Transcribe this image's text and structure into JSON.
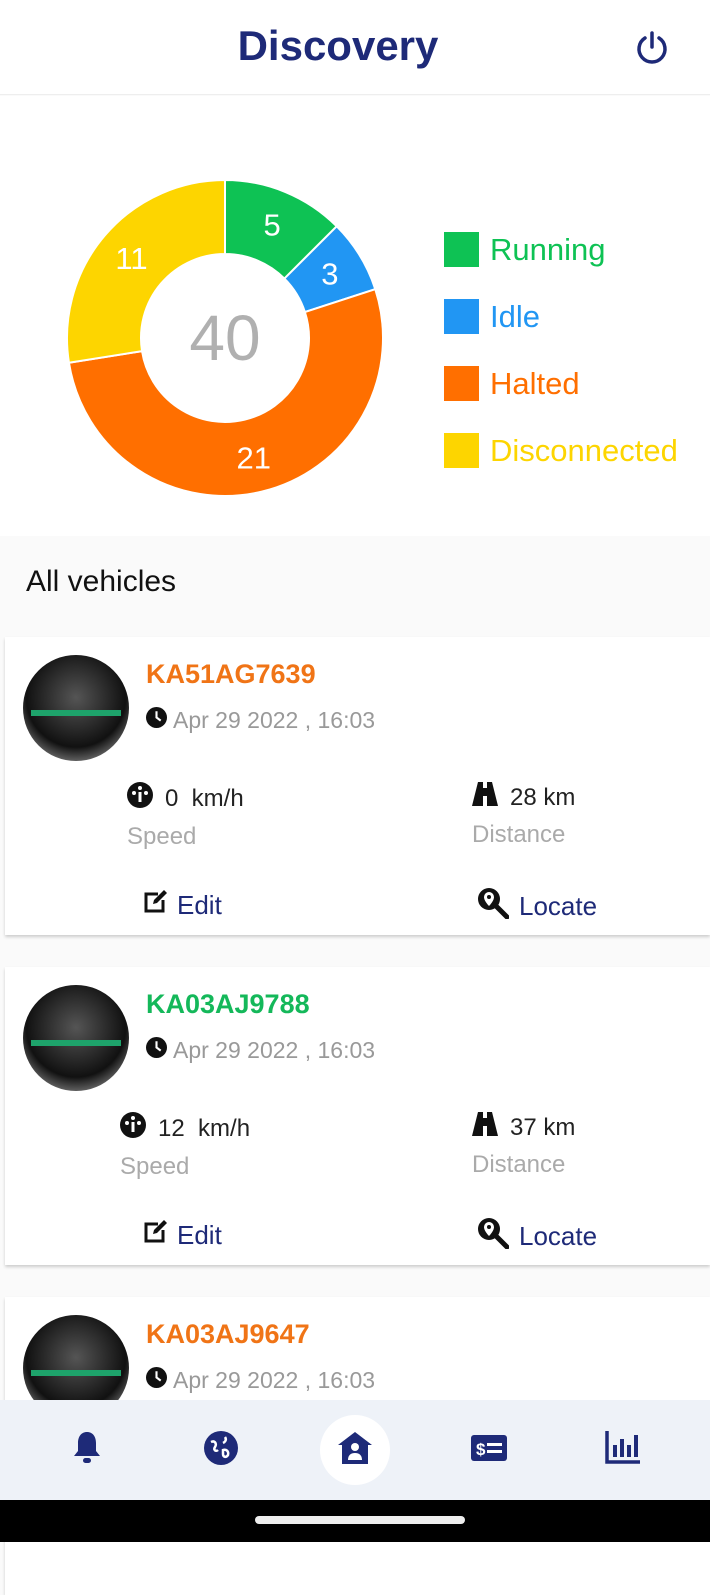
{
  "header": {
    "title": "Discovery",
    "power_icon": "power-icon"
  },
  "chart_data": {
    "type": "pie",
    "variant": "donut",
    "total": "40",
    "series": [
      {
        "name": "Running",
        "value": 5,
        "color": "#0ec254"
      },
      {
        "name": "Idle",
        "value": 3,
        "color": "#2196f3"
      },
      {
        "name": "Halted",
        "value": 21,
        "color": "#ff6f00"
      },
      {
        "name": "Disconnected",
        "value": 11,
        "color": "#fdd500"
      }
    ],
    "legend_placement": "right"
  },
  "section_title": "All vehicles",
  "vehicles": [
    {
      "plate": "KA51AG7639",
      "plate_color": "#f07416",
      "time": "Apr 29 2022 , 16:03",
      "speed": "0  km/h",
      "speed_label": "Speed",
      "distance": "28 km",
      "distance_label": "Distance",
      "edit": "Edit",
      "locate": "Locate"
    },
    {
      "plate": "KA03AJ9788",
      "plate_color": "#14b85a",
      "time": "Apr 29 2022 , 16:03",
      "speed": "12  km/h",
      "speed_label": "Speed",
      "distance": "37 km",
      "distance_label": "Distance",
      "edit": "Edit",
      "locate": "Locate"
    },
    {
      "plate": "KA03AJ9647",
      "plate_color": "#f07416",
      "time": "Apr 29 2022 , 16:03"
    }
  ],
  "nav": [
    "bell-icon",
    "globe-icon",
    "home-user-icon",
    "billing-icon",
    "chart-icon"
  ],
  "nav_active": "home-user-icon"
}
